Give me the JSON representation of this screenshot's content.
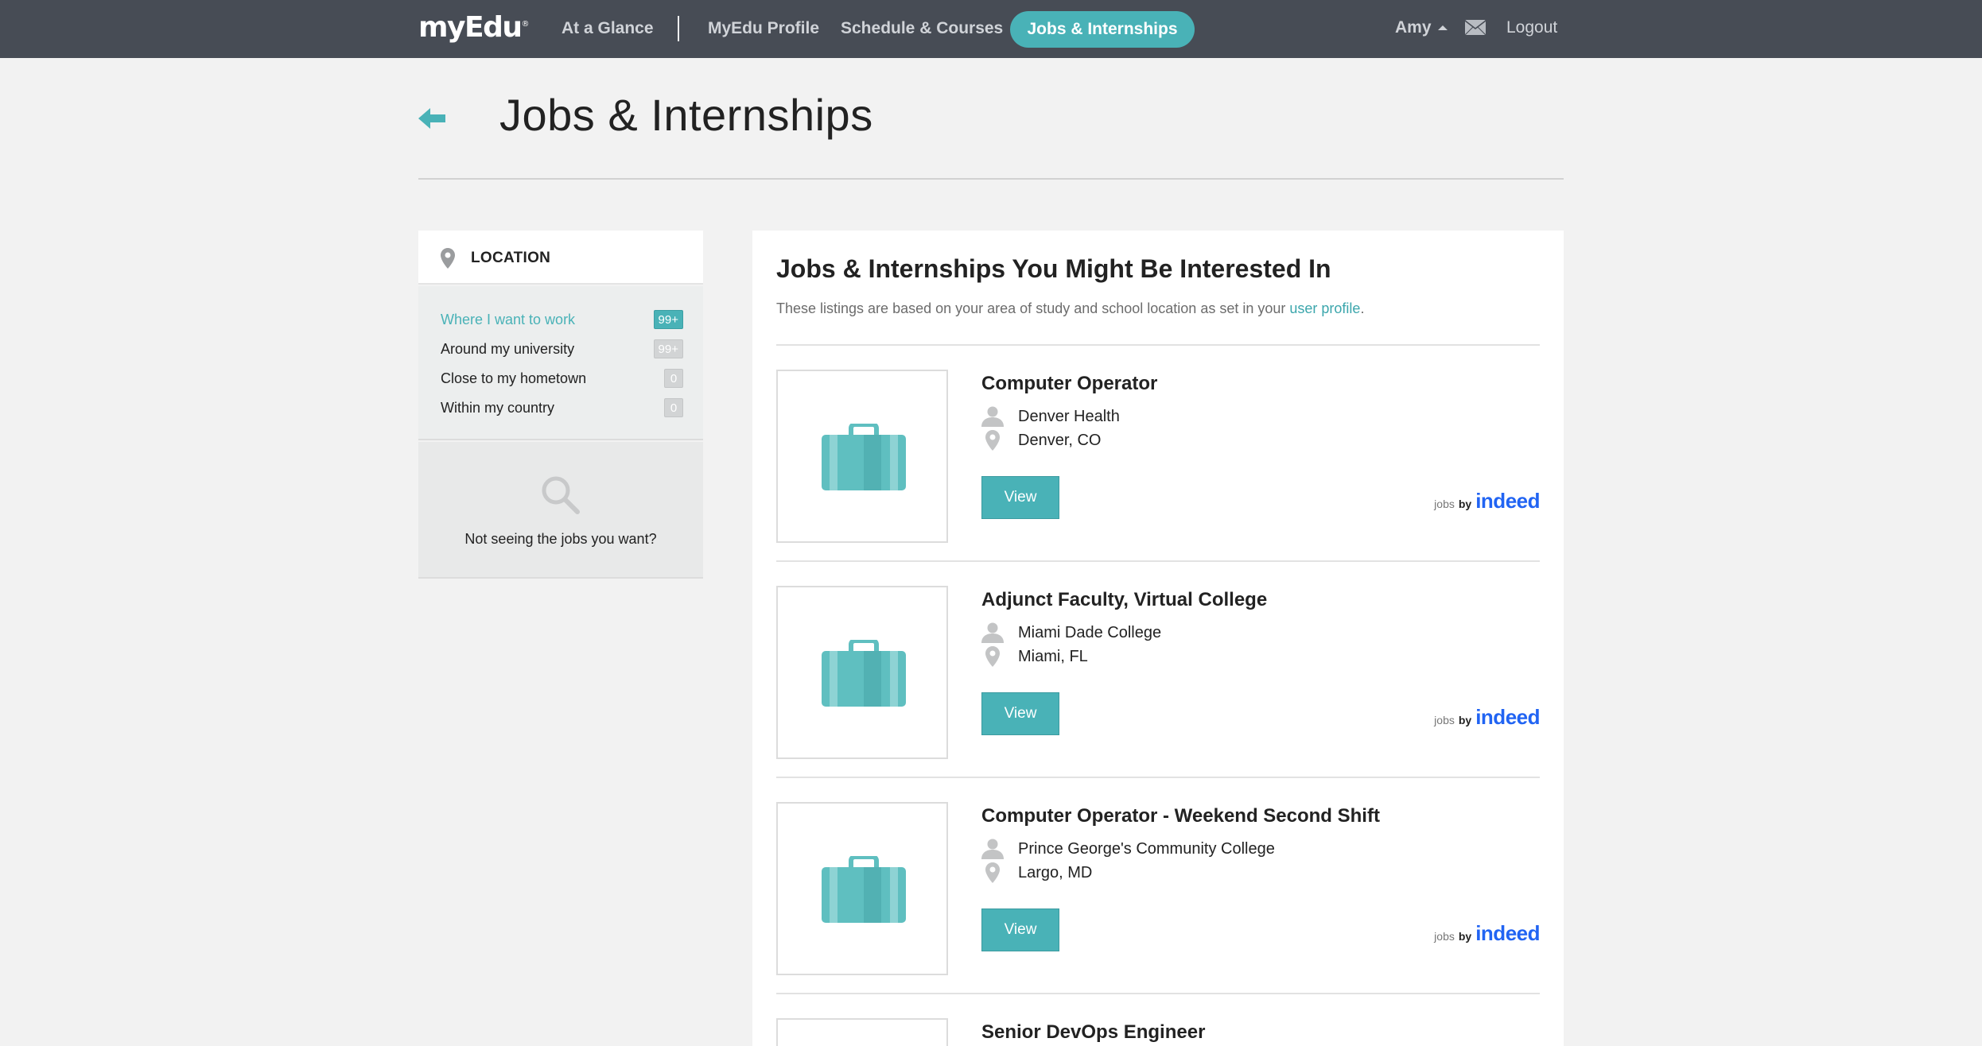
{
  "nav": {
    "logo": "myEdu",
    "links": [
      "At a Glance",
      "MyEdu Profile",
      "Schedule & Courses"
    ],
    "active": "Jobs & Internships",
    "user": "Amy",
    "logout": "Logout"
  },
  "header": {
    "title": "Jobs & Internships"
  },
  "sidebar": {
    "heading": "LOCATION",
    "items": [
      {
        "label": "Where I want to work",
        "count": "99+"
      },
      {
        "label": "Around my university",
        "count": "99+"
      },
      {
        "label": "Close to my hometown",
        "count": "0"
      },
      {
        "label": "Within my country",
        "count": "0"
      }
    ],
    "search_prompt": "Not seeing the jobs you want?"
  },
  "main": {
    "title": "Jobs & Internships You Might Be Interested In",
    "subtitle": "These listings are based on your area of study and school location as set in your",
    "subtitle_link": "user profile",
    "subtitle_end": ".",
    "view_label": "View",
    "attribution": {
      "jobs": "jobs",
      "by": "by",
      "brand": "indeed"
    },
    "jobs": [
      {
        "title": "Computer Operator",
        "employer": "Denver Health",
        "location": "Denver, CO"
      },
      {
        "title": "Adjunct Faculty, Virtual College",
        "employer": "Miami Dade College",
        "location": "Miami, FL"
      },
      {
        "title": "Computer Operator - Weekend Second Shift",
        "employer": "Prince George's Community College",
        "location": "Largo, MD"
      },
      {
        "title": "Senior DevOps Engineer"
      }
    ]
  },
  "colors": {
    "accent": "#49b2b7",
    "nav_bg": "#474c55",
    "indeed": "#2164f3"
  }
}
